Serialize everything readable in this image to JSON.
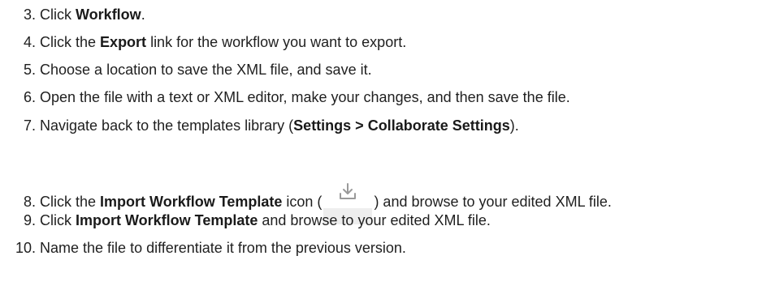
{
  "steps": [
    {
      "number": "3.",
      "before": "Click ",
      "bold": "Workflow",
      "after": "."
    },
    {
      "number": "4.",
      "before": "Click the ",
      "bold": "Export",
      "after": " link for the workflow you want to export."
    },
    {
      "number": "5.",
      "text": "Choose a location to save the XML file, and save it."
    },
    {
      "number": "6.",
      "text": "Open the file with a text or XML editor, make your changes, and then save the file."
    },
    {
      "number": "7.",
      "before": "Navigate back to the templates library (",
      "bold": "Settings > Collaborate Settings",
      "after": ")."
    },
    {
      "number": "8.",
      "before": "Click the ",
      "bold": "Import Workflow Template",
      "middle": " icon (",
      "after": ") and browse to your edited XML file.",
      "icon": "download-icon"
    },
    {
      "number": "9.",
      "before": "Click ",
      "bold": "Import Workflow Template",
      "after": " and browse to your edited XML file."
    },
    {
      "number": "10.",
      "text": "Name the file to differentiate it from the previous version."
    }
  ]
}
